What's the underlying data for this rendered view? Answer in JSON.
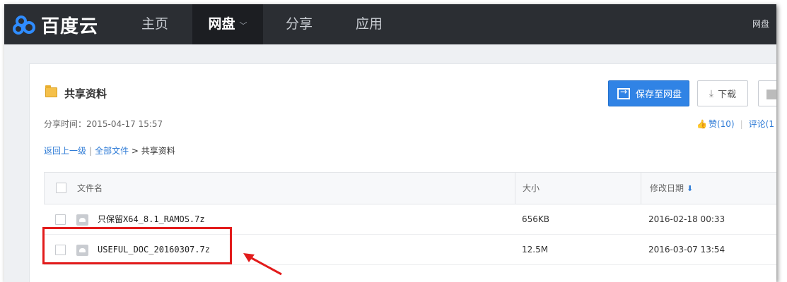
{
  "brand": {
    "name": "百度云"
  },
  "nav": {
    "items": [
      {
        "label": "主页"
      },
      {
        "label": "网盘"
      },
      {
        "label": "分享"
      },
      {
        "label": "应用"
      }
    ],
    "right_link": "网盘"
  },
  "folder": {
    "title": "共享资料",
    "share_time": "分享时间：2015-04-17 15:57"
  },
  "breadcrumb": {
    "back": "返回上一级",
    "all_files": "全部文件",
    "current": "> 共享资料"
  },
  "actions": {
    "save_label": "保存至网盘",
    "download_label": "下载"
  },
  "social": {
    "likes": "赞(10)",
    "comments": "评论(1"
  },
  "table": {
    "columns": {
      "name": "文件名",
      "size": "大小",
      "date": "修改日期"
    },
    "rows": [
      {
        "name": "只保留X64_8.1_RAMOS.7z",
        "size": "656KB",
        "date": "2016-02-18 00:33"
      },
      {
        "name": "USEFUL_DOC_20160307.7z",
        "size": "12.5M",
        "date": "2016-03-07 13:54"
      }
    ]
  },
  "colors": {
    "topbar": "#2b2e33",
    "accent": "#3083e5",
    "link": "#2e7bd6",
    "annotation": "#e21b1b"
  }
}
